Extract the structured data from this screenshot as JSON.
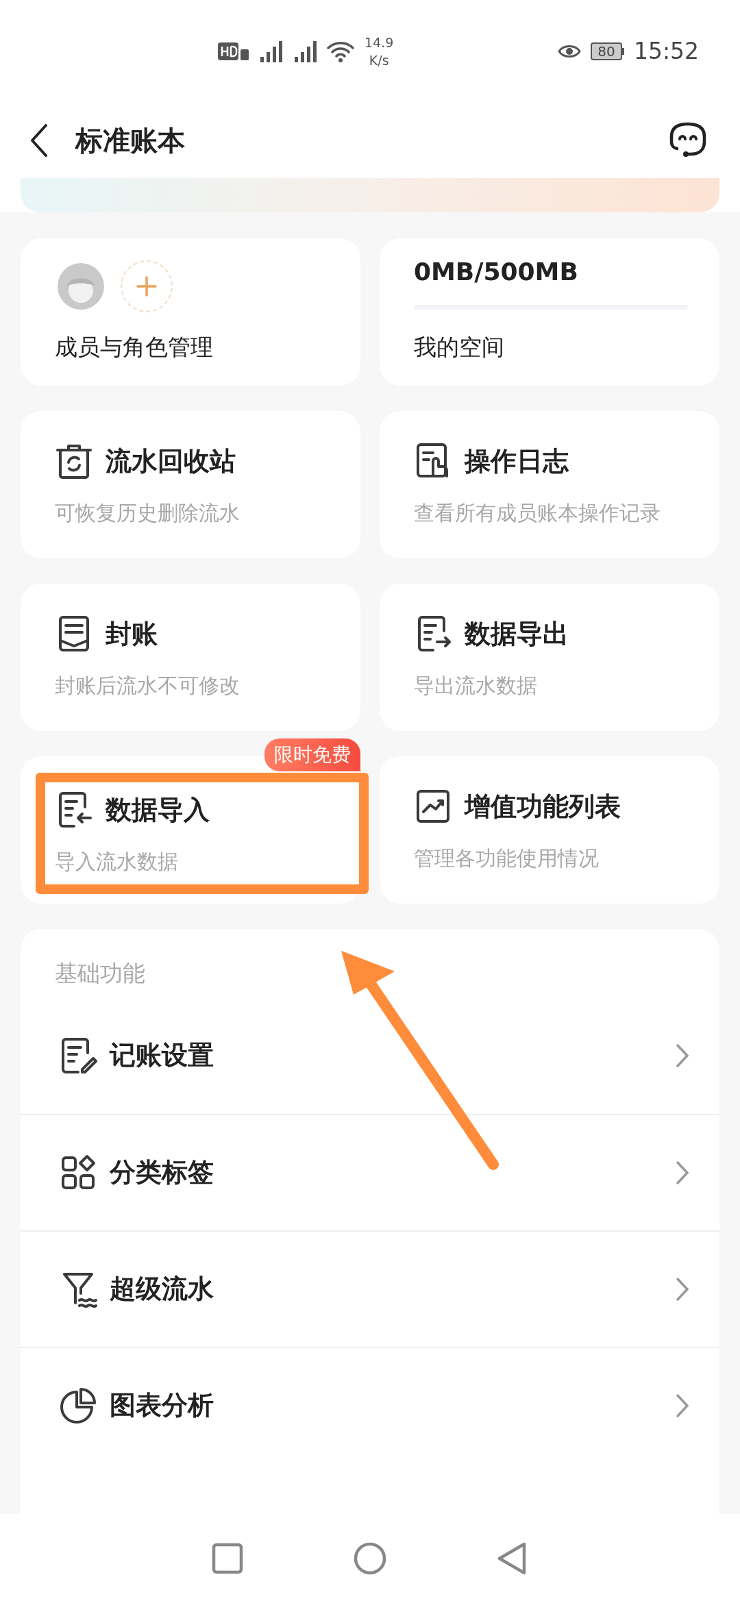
{
  "status_bar": {
    "speed_value": "14.9",
    "speed_unit": "K/s",
    "battery": "80",
    "time": "15:52"
  },
  "header": {
    "title": "标准账本"
  },
  "members_card": {
    "title": "成员与角色管理"
  },
  "storage_card": {
    "value": "0MB/500MB",
    "level": 0,
    "title": "我的空间"
  },
  "features": [
    {
      "title": "流水回收站",
      "subtitle": "可恢复历史删除流水"
    },
    {
      "title": "操作日志",
      "subtitle": "查看所有成员账本操作记录"
    },
    {
      "title": "封账",
      "subtitle": "封账后流水不可修改"
    },
    {
      "title": "数据导出",
      "subtitle": "导出流水数据"
    },
    {
      "title": "数据导入",
      "subtitle": "导入流水数据",
      "badge": "限时免费",
      "highlighted": true
    },
    {
      "title": "增值功能列表",
      "subtitle": "管理各功能使用情况"
    }
  ],
  "section": {
    "title": "基础功能",
    "items": [
      {
        "label": "记账设置"
      },
      {
        "label": "分类标签"
      },
      {
        "label": "超级流水"
      },
      {
        "label": "图表分析"
      }
    ]
  }
}
